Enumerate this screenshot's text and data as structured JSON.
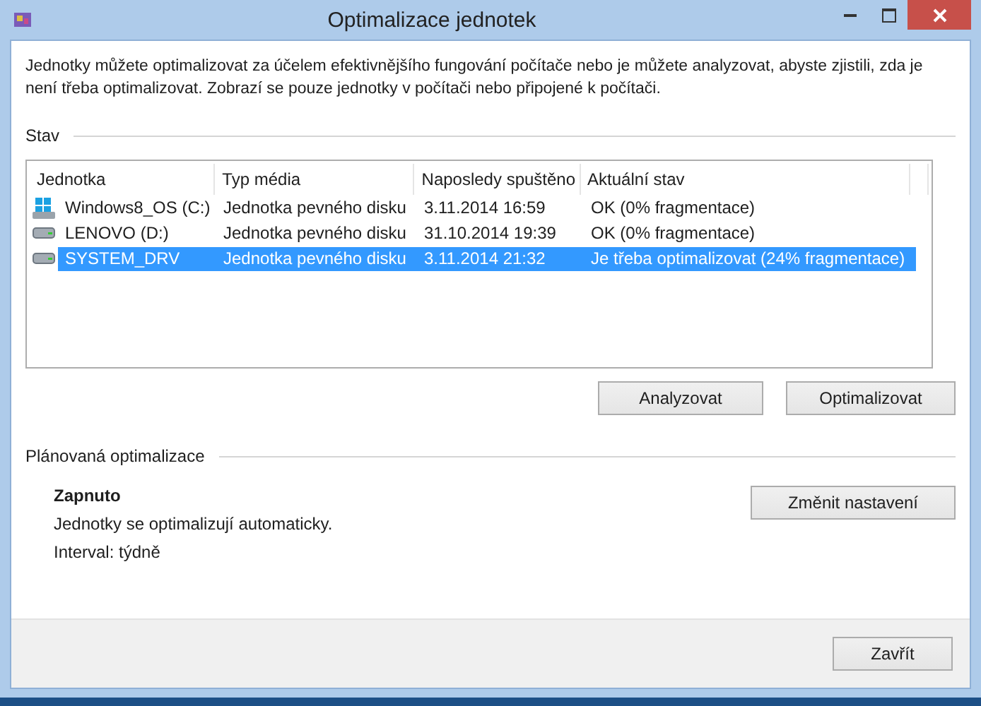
{
  "window": {
    "title": "Optimalizace jednotek"
  },
  "intro": "Jednotky můžete optimalizovat za účelem efektivnějšího fungování počítače nebo je můžete analyzovat, abyste zjistili, zda je není třeba optimalizovat. Zobrazí se pouze jednotky v počítači nebo připojené k počítači.",
  "status_section": {
    "title": "Stav"
  },
  "table": {
    "columns": [
      "Jednotka",
      "Typ média",
      "Naposledy spuštěno",
      "Aktuální stav"
    ],
    "rows": [
      {
        "kind": "system",
        "selected": false,
        "cells": [
          "Windows8_OS (C:)",
          "Jednotka pevného disku",
          "3.11.2014 16:59",
          "OK (0% fragmentace)"
        ]
      },
      {
        "kind": "disk",
        "selected": false,
        "cells": [
          "LENOVO (D:)",
          "Jednotka pevného disku",
          "31.10.2014 19:39",
          "OK (0% fragmentace)"
        ]
      },
      {
        "kind": "disk",
        "selected": true,
        "cells": [
          "SYSTEM_DRV",
          "Jednotka pevného disku",
          "3.11.2014 21:32",
          "Je třeba optimalizovat (24% fragmentace)"
        ]
      }
    ]
  },
  "actions": [
    "Analyzovat",
    "Optimalizovat"
  ],
  "schedule": {
    "title": "Plánovaná optimalizace",
    "state": "Zapnuto",
    "description": "Jednotky se optimalizují automaticky.",
    "interval": "Interval: týdně",
    "button": "Změnit nastavení"
  },
  "footer": {
    "button": "Zavřít"
  }
}
